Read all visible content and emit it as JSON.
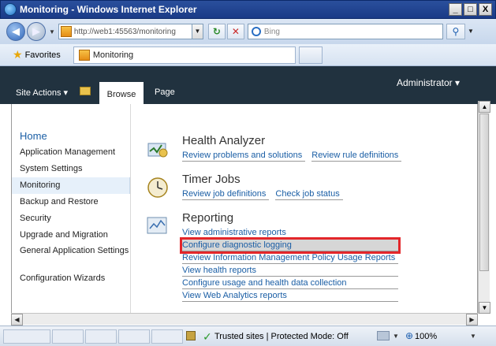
{
  "window": {
    "title": "Monitoring - Windows Internet Explorer",
    "min": "_",
    "max": "□",
    "close": "X"
  },
  "address": {
    "url": "http://web1:45563/monitoring",
    "search_placeholder": "Bing"
  },
  "favorites": {
    "label": "Favorites",
    "tab_title": "Monitoring"
  },
  "ribbon": {
    "site_actions": "Site Actions ▾",
    "tab_browse": "Browse",
    "tab_page": "Page",
    "user": "Administrator ▾"
  },
  "nav": {
    "home": "Home",
    "items": [
      "Application Management",
      "System Settings",
      "Monitoring",
      "Backup and Restore",
      "Security",
      "Upgrade and Migration",
      "General Application Settings",
      "Configuration Wizards"
    ]
  },
  "health": {
    "title": "Health Analyzer",
    "links": [
      "Review problems and solutions",
      "Review rule definitions"
    ]
  },
  "timer": {
    "title": "Timer Jobs",
    "links": [
      "Review job definitions",
      "Check job status"
    ]
  },
  "reporting": {
    "title": "Reporting",
    "links": [
      "View administrative reports",
      "Configure diagnostic logging",
      "Review Information Management Policy Usage Reports",
      "View health reports",
      "Configure usage and health data collection",
      "View Web Analytics reports"
    ]
  },
  "status": {
    "zone": "Trusted sites | Protected Mode: Off",
    "zoom": "100%"
  },
  "colors": {
    "ribbon": "#21323f",
    "link": "#1a5ea5",
    "highlight": "#e3262a"
  }
}
